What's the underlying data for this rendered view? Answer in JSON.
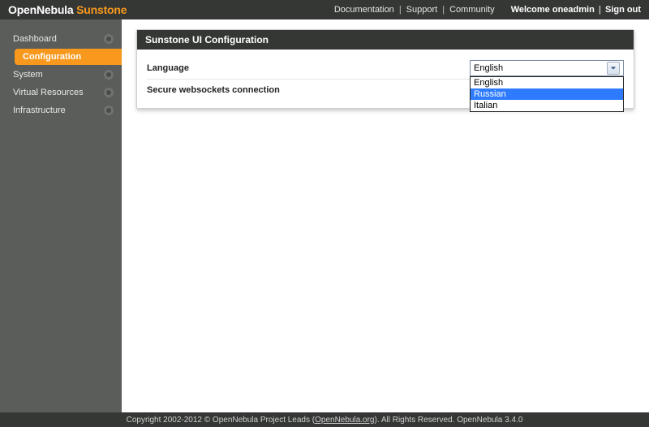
{
  "brand": {
    "part1": "OpenNebula",
    "part2": " Sunstone"
  },
  "top_links": {
    "documentation": "Documentation",
    "support": "Support",
    "community": "Community"
  },
  "welcome": {
    "prefix": "Welcome ",
    "user": "oneadmin",
    "signout": "Sign out"
  },
  "sidebar": {
    "items": [
      {
        "label": "Dashboard"
      },
      {
        "label": "Configuration"
      },
      {
        "label": "System"
      },
      {
        "label": "Virtual Resources"
      },
      {
        "label": "Infrastructure"
      }
    ]
  },
  "panel": {
    "title": "Sunstone UI Configuration",
    "rows": {
      "language_label": "Language",
      "wss_label": "Secure websockets connection"
    }
  },
  "language_select": {
    "selected": "English",
    "options": [
      "English",
      "Russian",
      "Italian"
    ],
    "highlight_index": 1
  },
  "footer": {
    "pre": "Copyright 2002-2012 © OpenNebula Project Leads (",
    "link_text": "OpenNebula.org",
    "post": "). All Rights Reserved. OpenNebula 3.4.0"
  }
}
